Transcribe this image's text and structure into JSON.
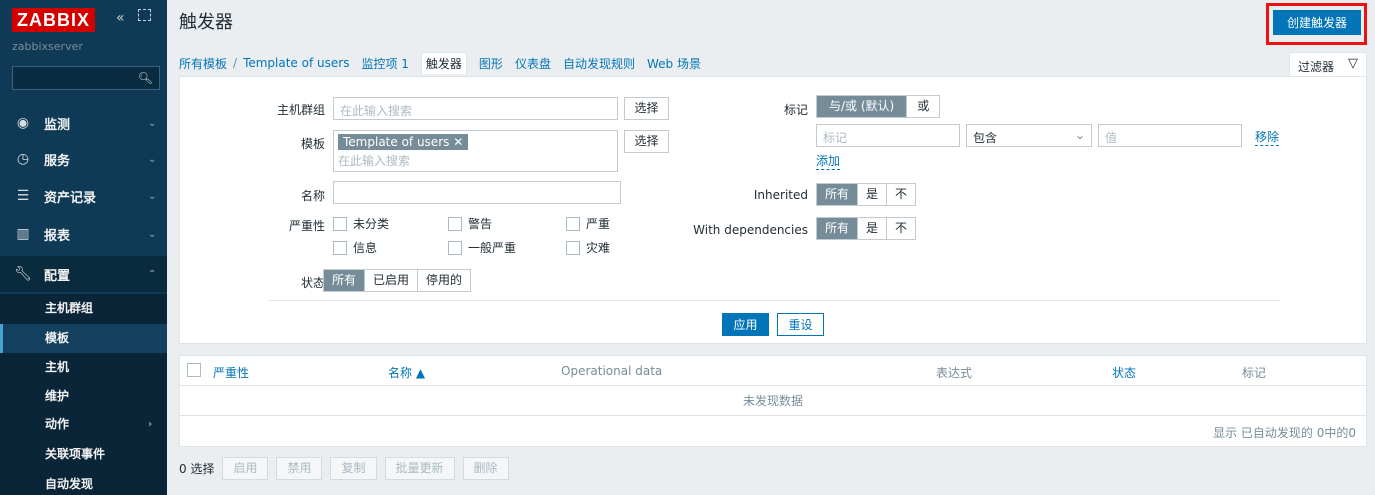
{
  "sidebar": {
    "logo": "ZABBIX",
    "server_name": "zabbixserver",
    "collapse_icon": "double-chevron-left-icon",
    "kiosk_icon": "fullscreen-icon",
    "search_icon": "search-icon",
    "items": [
      {
        "label": "监测",
        "icon": "eye-icon",
        "arrow": "⌄"
      },
      {
        "label": "服务",
        "icon": "clock-icon",
        "arrow": "⌄"
      },
      {
        "label": "资产记录",
        "icon": "list-icon",
        "arrow": "⌄"
      },
      {
        "label": "报表",
        "icon": "bar-chart-icon",
        "arrow": "⌄"
      },
      {
        "label": "配置",
        "icon": "wrench-icon",
        "arrow": "⌃"
      }
    ],
    "submenu": [
      {
        "label": "主机群组"
      },
      {
        "label": "模板",
        "active": true
      },
      {
        "label": "主机"
      },
      {
        "label": "维护"
      },
      {
        "label": "动作",
        "arrow": "›"
      },
      {
        "label": "关联项事件"
      },
      {
        "label": "自动发现"
      }
    ]
  },
  "header": {
    "title": "触发器",
    "create_button": "创建触发器"
  },
  "tabs": {
    "breadcrumb_root": "所有模板",
    "separator": "/",
    "template": "Template of users",
    "items": "监控项 1",
    "triggers": "触发器",
    "graphs": "图形",
    "dashboards": "仪表盘",
    "discovery": "自动发现规则",
    "web": "Web 场景",
    "filter_label": "过滤器"
  },
  "filter": {
    "host_groups_label": "主机群组",
    "host_groups_placeholder": "在此输入搜索",
    "select_button": "选择",
    "templates_label": "模板",
    "template_chip": "Template of users",
    "templates_placeholder": "在此输入搜索",
    "name_label": "名称",
    "name_value": "",
    "severity_label": "严重性",
    "severities": [
      "未分类",
      "警告",
      "严重",
      "信息",
      "一般严重",
      "灾难"
    ],
    "state_label": "状态",
    "state_options": [
      "所有",
      "已启用",
      "停用的"
    ],
    "tags_label": "标记",
    "tags_mode": [
      "与/或 (默认)",
      "或"
    ],
    "tag_placeholder": "标记",
    "tag_operator": "包含",
    "value_placeholder": "值",
    "remove_link": "移除",
    "add_link": "添加",
    "inherited_label": "Inherited",
    "inherited_options": [
      "所有",
      "是",
      "不"
    ],
    "deps_label": "With dependencies",
    "deps_options": [
      "所有",
      "是",
      "不"
    ],
    "apply_button": "应用",
    "reset_button": "重设"
  },
  "table": {
    "columns": [
      "严重性",
      "名称 ▲",
      "Operational data",
      "表达式",
      "状态",
      "标记"
    ],
    "no_data": "未发现数据",
    "paging_info": "显示 已自动发现的 0中的0"
  },
  "actions": {
    "selected": "0 选择",
    "buttons": [
      "启用",
      "禁用",
      "复制",
      "批量更新",
      "删除"
    ]
  },
  "colors": {
    "sidebar_bg": "#0e3a56",
    "accent": "#0275b8",
    "logo_red": "#d40000",
    "highlight_box": "#e11111"
  }
}
